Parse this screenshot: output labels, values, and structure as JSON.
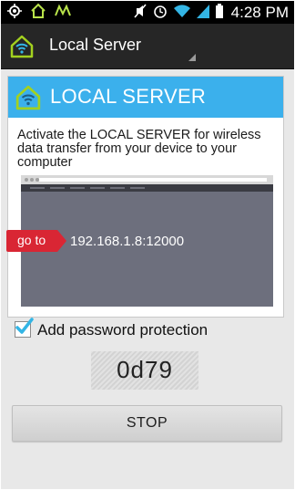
{
  "status_bar": {
    "time": "4:28",
    "time_suffix": "PM",
    "icons": [
      "gps-icon",
      "home-icon",
      "app-notification-icon",
      "mute-icon",
      "alarm-icon",
      "wifi-icon",
      "signal-icon",
      "battery-icon"
    ]
  },
  "action_bar": {
    "title": "Local Server"
  },
  "card": {
    "title": "LOCAL SERVER",
    "description": "Activate the LOCAL SERVER for wireless data transfer from your device to your computer",
    "goto_label": "go to",
    "server_address": "192.168.1.8:12000"
  },
  "password_option": {
    "label": "Add password protection",
    "checked": true,
    "code": "0d79"
  },
  "stop_button": {
    "label": "STOP"
  },
  "colors": {
    "header_blue": "#3bb0ec",
    "goto_red": "#d92634",
    "action_bar": "#262626",
    "logo_green": "#a3d11f"
  }
}
